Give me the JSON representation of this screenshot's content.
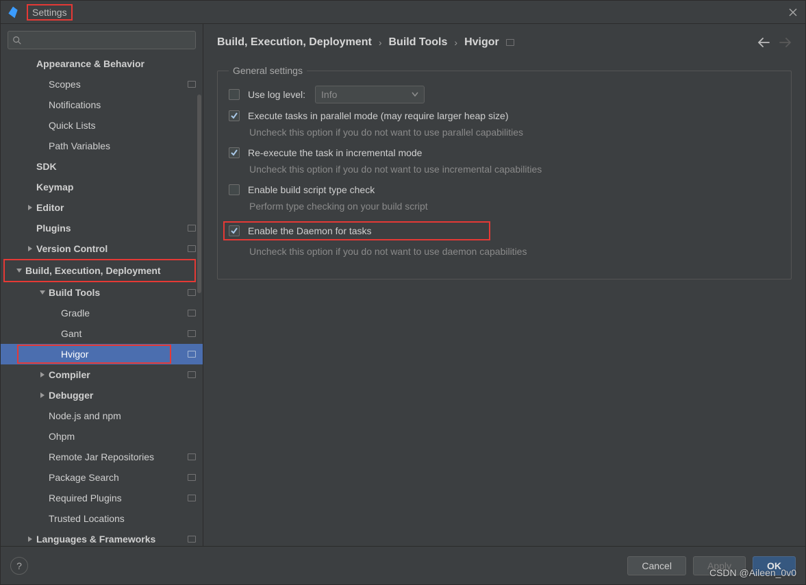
{
  "window": {
    "title": "Settings"
  },
  "search": {
    "placeholder": ""
  },
  "breadcrumb": {
    "a": "Build, Execution, Deployment",
    "b": "Build Tools",
    "c": "Hvigor"
  },
  "group": {
    "title": "General settings"
  },
  "opts": {
    "log": {
      "label": "Use log level:",
      "value": "Info"
    },
    "parallel": {
      "label": "Execute tasks in parallel mode (may require larger heap size)",
      "desc": "Uncheck this option if you do not want to use parallel capabilities"
    },
    "incremental": {
      "label": "Re-execute the task in incremental mode",
      "desc": "Uncheck this option if you do not want to use incremental capabilities"
    },
    "typecheck": {
      "label": "Enable build script type check",
      "desc": "Perform type checking on your build script"
    },
    "daemon": {
      "label": "Enable the Daemon for tasks",
      "desc": "Uncheck this option if you do not want to use daemon capabilities"
    }
  },
  "buttons": {
    "cancel": "Cancel",
    "apply": "Apply",
    "ok": "OK",
    "help": "?"
  },
  "watermark": "CSDN @Aileen_0v0",
  "tree": {
    "appearance": "Appearance & Behavior",
    "scopes": "Scopes",
    "notifications": "Notifications",
    "quicklists": "Quick Lists",
    "pathvars": "Path Variables",
    "sdk": "SDK",
    "keymap": "Keymap",
    "editor": "Editor",
    "plugins": "Plugins",
    "versioncontrol": "Version Control",
    "bed": "Build, Execution, Deployment",
    "buildtools": "Build Tools",
    "gradle": "Gradle",
    "gant": "Gant",
    "hvigor": "Hvigor",
    "compiler": "Compiler",
    "debugger": "Debugger",
    "nodejs": "Node.js and npm",
    "ohpm": "Ohpm",
    "remotejar": "Remote Jar Repositories",
    "pkgsearch": "Package Search",
    "reqplugins": "Required Plugins",
    "trusted": "Trusted Locations",
    "langfw": "Languages & Frameworks"
  }
}
